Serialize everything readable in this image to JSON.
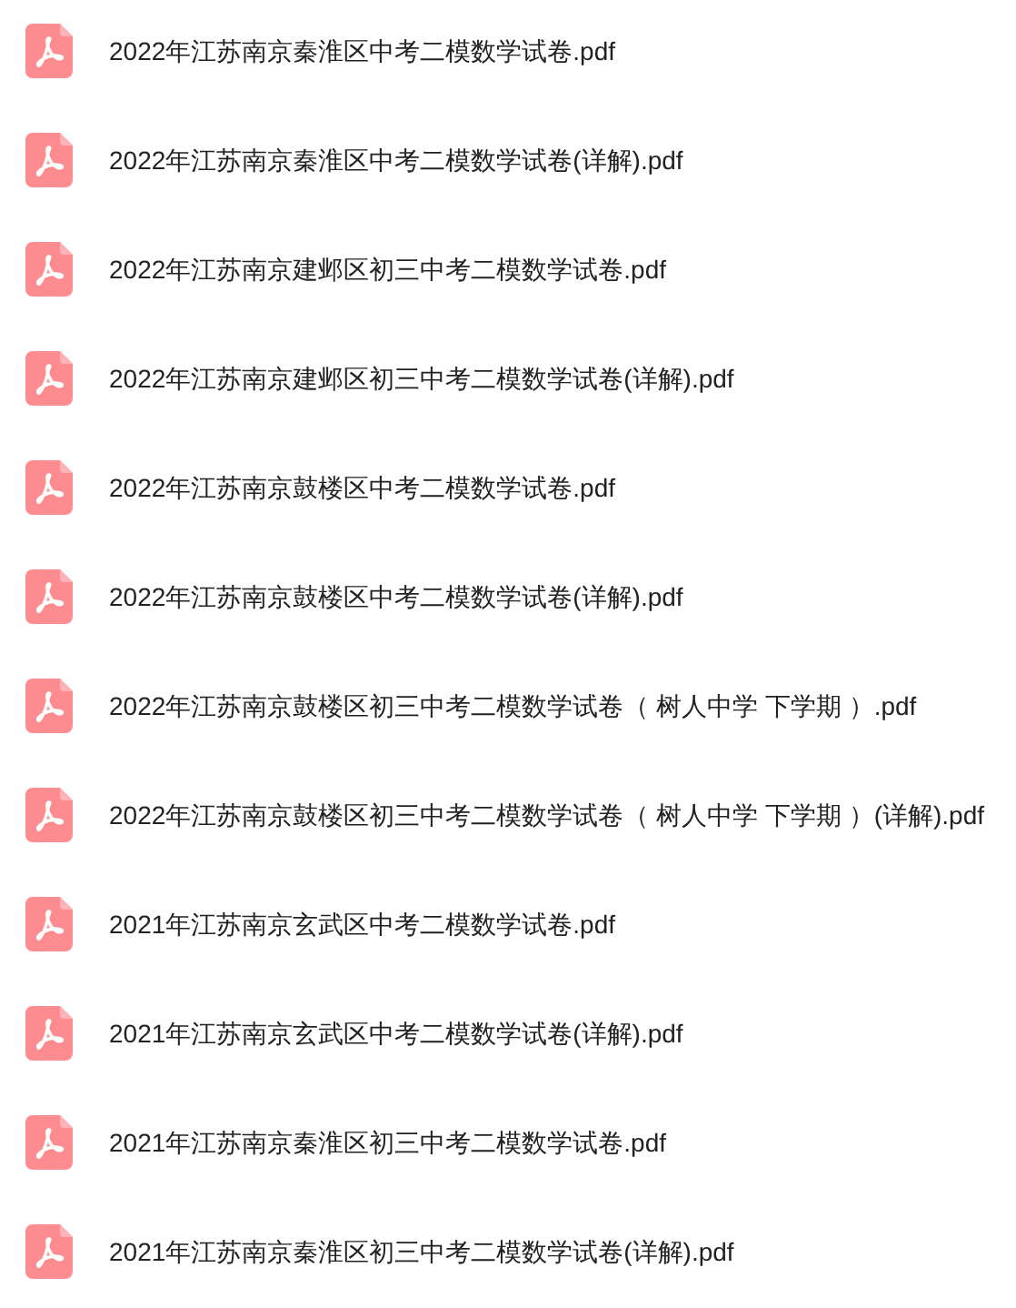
{
  "files": [
    {
      "name": "2022年江苏南京秦淮区中考二模数学试卷.pdf"
    },
    {
      "name": "2022年江苏南京秦淮区中考二模数学试卷(详解).pdf"
    },
    {
      "name": "2022年江苏南京建邺区初三中考二模数学试卷.pdf"
    },
    {
      "name": "2022年江苏南京建邺区初三中考二模数学试卷(详解).pdf"
    },
    {
      "name": "2022年江苏南京鼓楼区中考二模数学试卷.pdf"
    },
    {
      "name": "2022年江苏南京鼓楼区中考二模数学试卷(详解).pdf"
    },
    {
      "name": "2022年江苏南京鼓楼区初三中考二模数学试卷（ 树人中学 下学期 ）.pdf"
    },
    {
      "name": "2022年江苏南京鼓楼区初三中考二模数学试卷（ 树人中学 下学期 ）(详解).pdf"
    },
    {
      "name": "2021年江苏南京玄武区中考二模数学试卷.pdf"
    },
    {
      "name": "2021年江苏南京玄武区中考二模数学试卷(详解).pdf"
    },
    {
      "name": "2021年江苏南京秦淮区初三中考二模数学试卷.pdf"
    },
    {
      "name": "2021年江苏南京秦淮区初三中考二模数学试卷(详解).pdf"
    }
  ]
}
